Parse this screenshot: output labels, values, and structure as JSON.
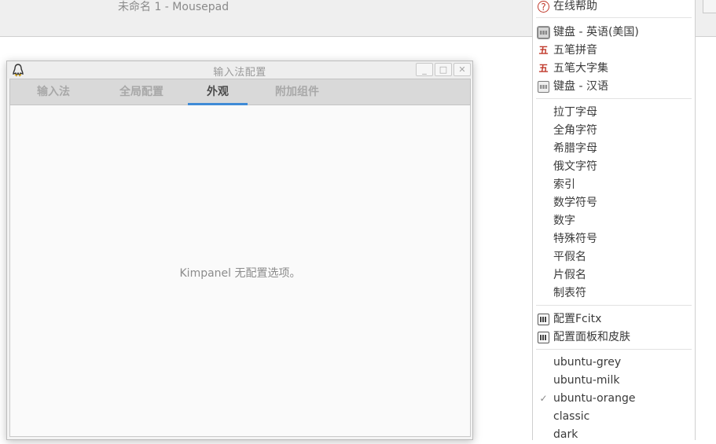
{
  "background_window": {
    "title": "未命名 1 - Mousepad"
  },
  "config_window": {
    "title": "输入法配置",
    "controls": {
      "minimize": "_",
      "maximize": "□",
      "close": "✕"
    },
    "tabs": [
      {
        "label": "输入法",
        "active": false
      },
      {
        "label": "全局配置",
        "active": false
      },
      {
        "label": "外观",
        "active": true
      },
      {
        "label": "附加组件",
        "active": false
      }
    ],
    "content_message": "Kimpanel 无配置选项。"
  },
  "menu": {
    "help": {
      "label": "在线帮助",
      "icon": "help-icon"
    },
    "input_methods": [
      {
        "label": "键盘 - 英语(美国)",
        "icon": "keyboard-icon",
        "selected": true
      },
      {
        "label": "五笔拼音",
        "icon": "wubi-icon",
        "glyph": "五"
      },
      {
        "label": "五笔大字集",
        "icon": "wubi-icon",
        "glyph": "五"
      },
      {
        "label": "键盘 - 汉语",
        "icon": "keyboard-icon",
        "selected": false
      }
    ],
    "symbols": [
      "拉丁字母",
      "全角字符",
      "希腊字母",
      "俄文字符",
      "索引",
      "数学符号",
      "数字",
      "特殊符号",
      "平假名",
      "片假名",
      "制表符"
    ],
    "config": [
      {
        "label": "配置Fcitx",
        "icon": "config-icon"
      },
      {
        "label": "配置面板和皮肤",
        "icon": "config-icon"
      }
    ],
    "skins": [
      {
        "label": "ubuntu-grey",
        "checked": false
      },
      {
        "label": "ubuntu-milk",
        "checked": false
      },
      {
        "label": "ubuntu-orange",
        "checked": true
      },
      {
        "label": "classic",
        "checked": false
      },
      {
        "label": "dark",
        "checked": false
      }
    ],
    "check_glyph": "✓"
  },
  "colors": {
    "accent": "#3f8bd6",
    "wubi_red": "#c0392b"
  }
}
